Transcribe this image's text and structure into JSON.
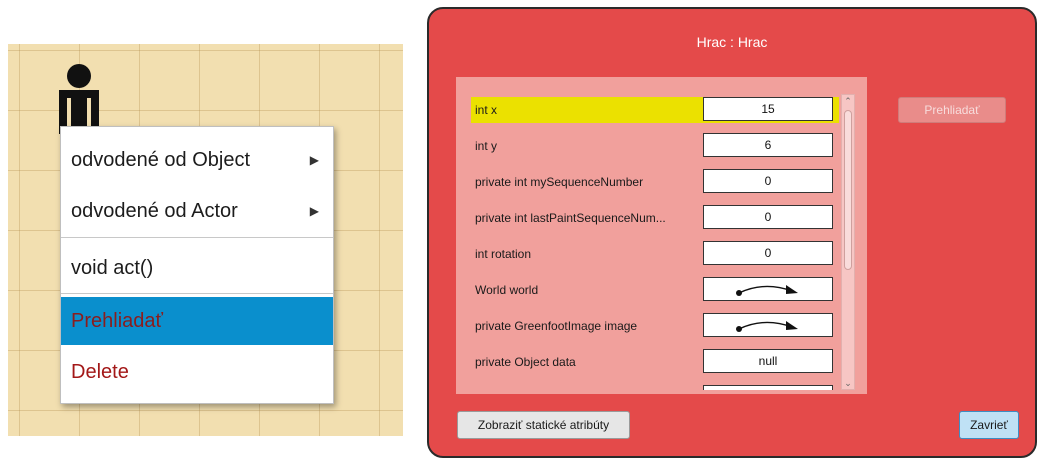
{
  "context_menu": {
    "items": [
      {
        "label": "odvodené od Object",
        "submenu": true
      },
      {
        "label": "odvodené od Actor",
        "submenu": true
      },
      {
        "label": "void act()",
        "submenu": false
      },
      {
        "label": "Prehliadať",
        "submenu": false,
        "selected": true
      },
      {
        "label": "Delete",
        "submenu": false
      }
    ],
    "submenu_glyph": "▶"
  },
  "actor": {
    "icon": "person-icon"
  },
  "inspector": {
    "title": "Hrac : Hrac",
    "fields": [
      {
        "name": "int x",
        "value": "15",
        "selected": true
      },
      {
        "name": "int y",
        "value": "6"
      },
      {
        "name": "private int mySequenceNumber",
        "value": "0"
      },
      {
        "name": "private int lastPaintSequenceNum...",
        "value": "0"
      },
      {
        "name": "int rotation",
        "value": "0"
      },
      {
        "name": "World world",
        "value": null,
        "reference": true
      },
      {
        "name": "private GreenfootImage image",
        "value": null,
        "reference": true
      },
      {
        "name": "private Object data",
        "value": "null"
      }
    ],
    "inspect_button": "Prehliadať",
    "static_button": "Zobraziť statické atribúty",
    "close_button": "Zavrieť",
    "scroll_up_glyph": "⌃",
    "scroll_down_glyph": "⌄"
  },
  "colors": {
    "window_bg": "#e44a4a",
    "panel_bg": "#f1a09c",
    "selected_field": "#ebe100",
    "menu_selected": "#0a8fcd"
  }
}
